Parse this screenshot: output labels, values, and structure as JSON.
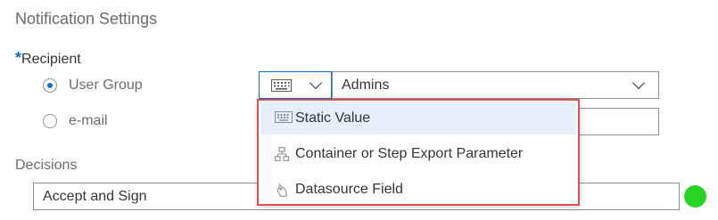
{
  "section": {
    "title": "Notification Settings"
  },
  "recipient": {
    "required_mark": "*",
    "label": "Recipient",
    "options": [
      {
        "label": "User Group",
        "selected": true
      },
      {
        "label": "e-mail",
        "selected": false
      }
    ],
    "group_value": "Admins",
    "type_icon": "keyboard-icon"
  },
  "source_menu": {
    "items": [
      {
        "label": "Static Value",
        "icon": "keyboard-icon",
        "highlighted": true
      },
      {
        "label": "Container or Step Export Parameter",
        "icon": "hierarchy-icon",
        "highlighted": false
      },
      {
        "label": "Datasource Field",
        "icon": "tag-icon",
        "highlighted": false
      }
    ]
  },
  "decisions": {
    "label": "Decisions",
    "value": "Accept and Sign",
    "status_color": "#27d424"
  },
  "colors": {
    "accent": "#0a6ed1",
    "highlight_border": "#e0514d",
    "menu_hover": "#e5f0fa"
  }
}
